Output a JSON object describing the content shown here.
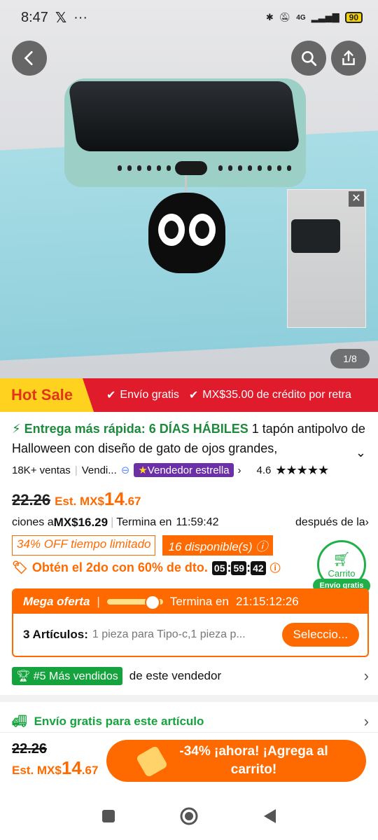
{
  "status_bar": {
    "time": "8:47",
    "battery": "90",
    "network": "4G"
  },
  "hero": {
    "counter": "1/8"
  },
  "banner": {
    "hot_label": "Hot Sale",
    "perk1": "Envío gratis",
    "perk2": "MX$35.00 de crédito por retra"
  },
  "product": {
    "fast_delivery": "Entrega más rápida: 6 DÍAS HÁBILES",
    "title": " 1 tapón antipolvo de Halloween con diseño de gato de ojos grandes,"
  },
  "stats": {
    "sales": "18K+ ventas",
    "seller": "Vendi...",
    "seller_badge": "Vendedor estrella",
    "rating": "4.6",
    "stars": "★★★★★"
  },
  "price": {
    "old": "22.26",
    "est_prefix": "Est. MX$",
    "est_main": "14",
    "est_cents": ".67"
  },
  "coupon": {
    "prefix": "ciones a ",
    "amount": "MX$16.29",
    "ends_label": "Termina en",
    "ends_time": "11:59:42",
    "after": "después de la"
  },
  "tags": {
    "discount": "34% OFF tiempo limitado",
    "stock": "16 disponible(s)"
  },
  "second_offer": {
    "label": "Obtén el 2do con 60% de dto.",
    "h": "05",
    "m": "59",
    "s": "42"
  },
  "cart": {
    "label": "Carrito",
    "free": "Envío gratis"
  },
  "mega": {
    "title": "Mega oferta",
    "ends_label": "Termina en",
    "ends_time": "21:15:12:26",
    "items_label": "3 Artículos:",
    "items_desc": "1 pieza para Tipo-c,1 pieza p...",
    "select": "Seleccio..."
  },
  "best": {
    "badge": "#5 Más vendidos",
    "text": "de este vendedor"
  },
  "shipping": {
    "label": "Envío gratis para este artículo"
  },
  "bottom": {
    "old": "22.26",
    "est_prefix": "Est. MX$",
    "est_main": "14",
    "est_cents": ".67",
    "add_line1": "-34% ¡ahora! ¡Agrega al",
    "add_line2": "carrito!"
  },
  "colors": {
    "accent": "#ff6a00",
    "green": "#14a33c",
    "banner_red": "#e01b2c"
  }
}
